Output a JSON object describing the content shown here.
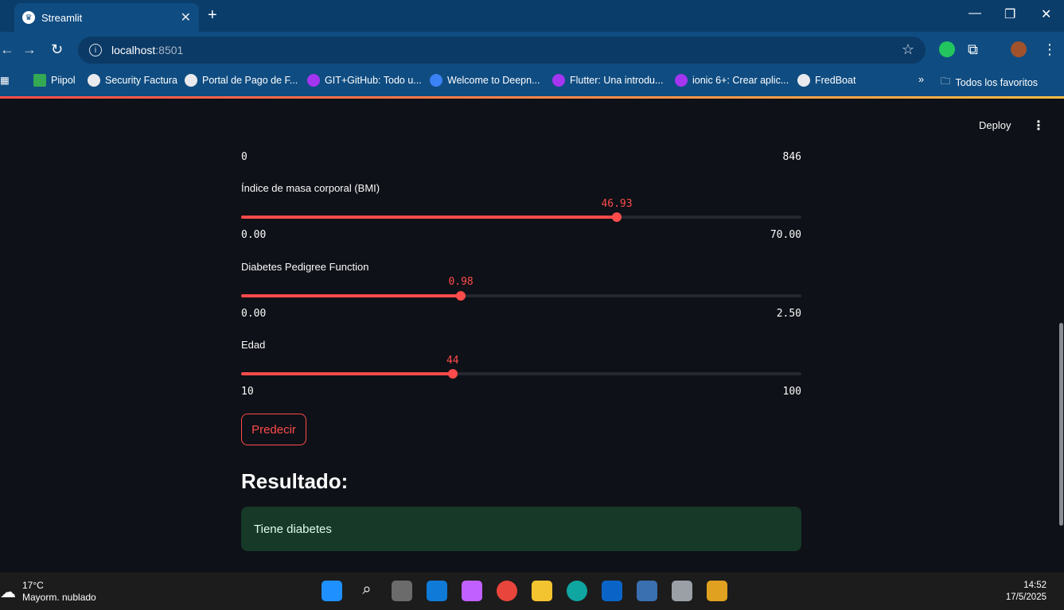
{
  "browser": {
    "tab_title": "Streamlit",
    "url_host": "localhost",
    "url_port": ":8501",
    "bookmarks": [
      "Piipol",
      "Security Factura",
      "Portal de Pago de F...",
      "GIT+GitHub: Todo u...",
      "Welcome to Deepn...",
      "Flutter: Una introdu...",
      "ionic 6+: Crear aplic...",
      "FredBoat"
    ],
    "all_bookmarks_label": "Todos los favoritos"
  },
  "app": {
    "deploy_label": "Deploy",
    "prev_slider": {
      "min": "0",
      "max": "846"
    },
    "sliders": [
      {
        "label": "Índice de masa corporal (BMI)",
        "value": "46.93",
        "min": "0.00",
        "max": "70.00",
        "fraction": 0.6704
      },
      {
        "label": "Diabetes Pedigree Function",
        "value": "0.98",
        "min": "0.00",
        "max": "2.50",
        "fraction": 0.392
      },
      {
        "label": "Edad",
        "value": "44",
        "min": "10",
        "max": "100",
        "fraction": 0.3778
      }
    ],
    "predict_button": "Predecir",
    "result_heading": "Resultado:",
    "result_text": "Tiene diabetes",
    "colors": {
      "primary": "#ff4b4b",
      "background": "#0e1117",
      "success_bg": "#173928"
    }
  },
  "taskbar": {
    "temperature": "17°C",
    "weather": "Mayorm. nublado",
    "time": "14:52",
    "date": "17/5/2025"
  }
}
